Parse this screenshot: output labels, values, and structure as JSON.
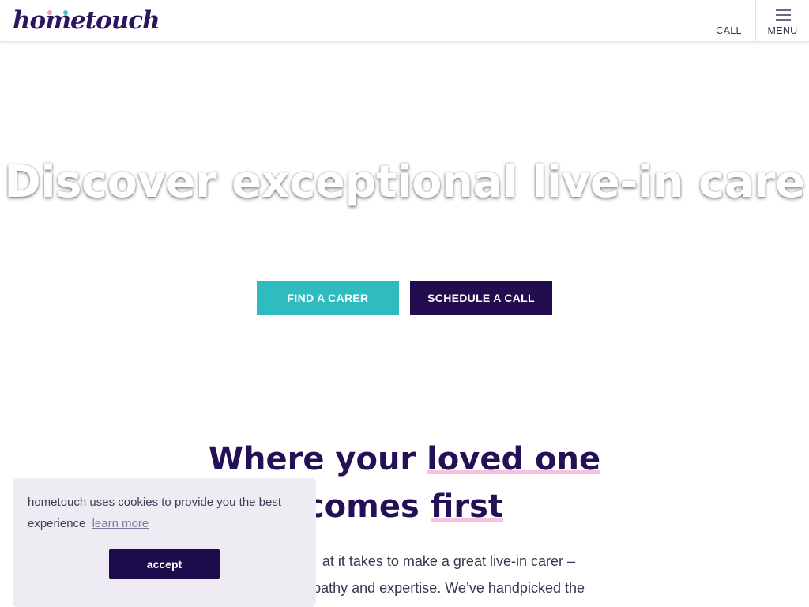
{
  "header": {
    "logo_text": "hometouch",
    "call_label": "CALL",
    "menu_label": "MENU"
  },
  "hero": {
    "title": "Discover exceptional live-in care",
    "find_button": "FIND A CARER",
    "schedule_button": "SCHEDULE A CALL"
  },
  "section": {
    "heading_part1": "Where your ",
    "heading_highlight1": "loved one",
    "heading_part2": "comes ",
    "heading_highlight2": "first",
    "para_line1_prefix": "at it takes to make a ",
    "para_line1_link": "great live-in carer",
    "para_line1_suffix": " –",
    "para_line2": ", empathy and expertise. We’ve handpicked the"
  },
  "cookie": {
    "text": "hometouch uses cookies to provide you the best experience",
    "learn_more": "learn more",
    "accept": "accept"
  },
  "colors": {
    "brand_dark": "#220d4f",
    "brand_teal": "#2fbcc0",
    "highlight_pink": "#f6c2db"
  }
}
